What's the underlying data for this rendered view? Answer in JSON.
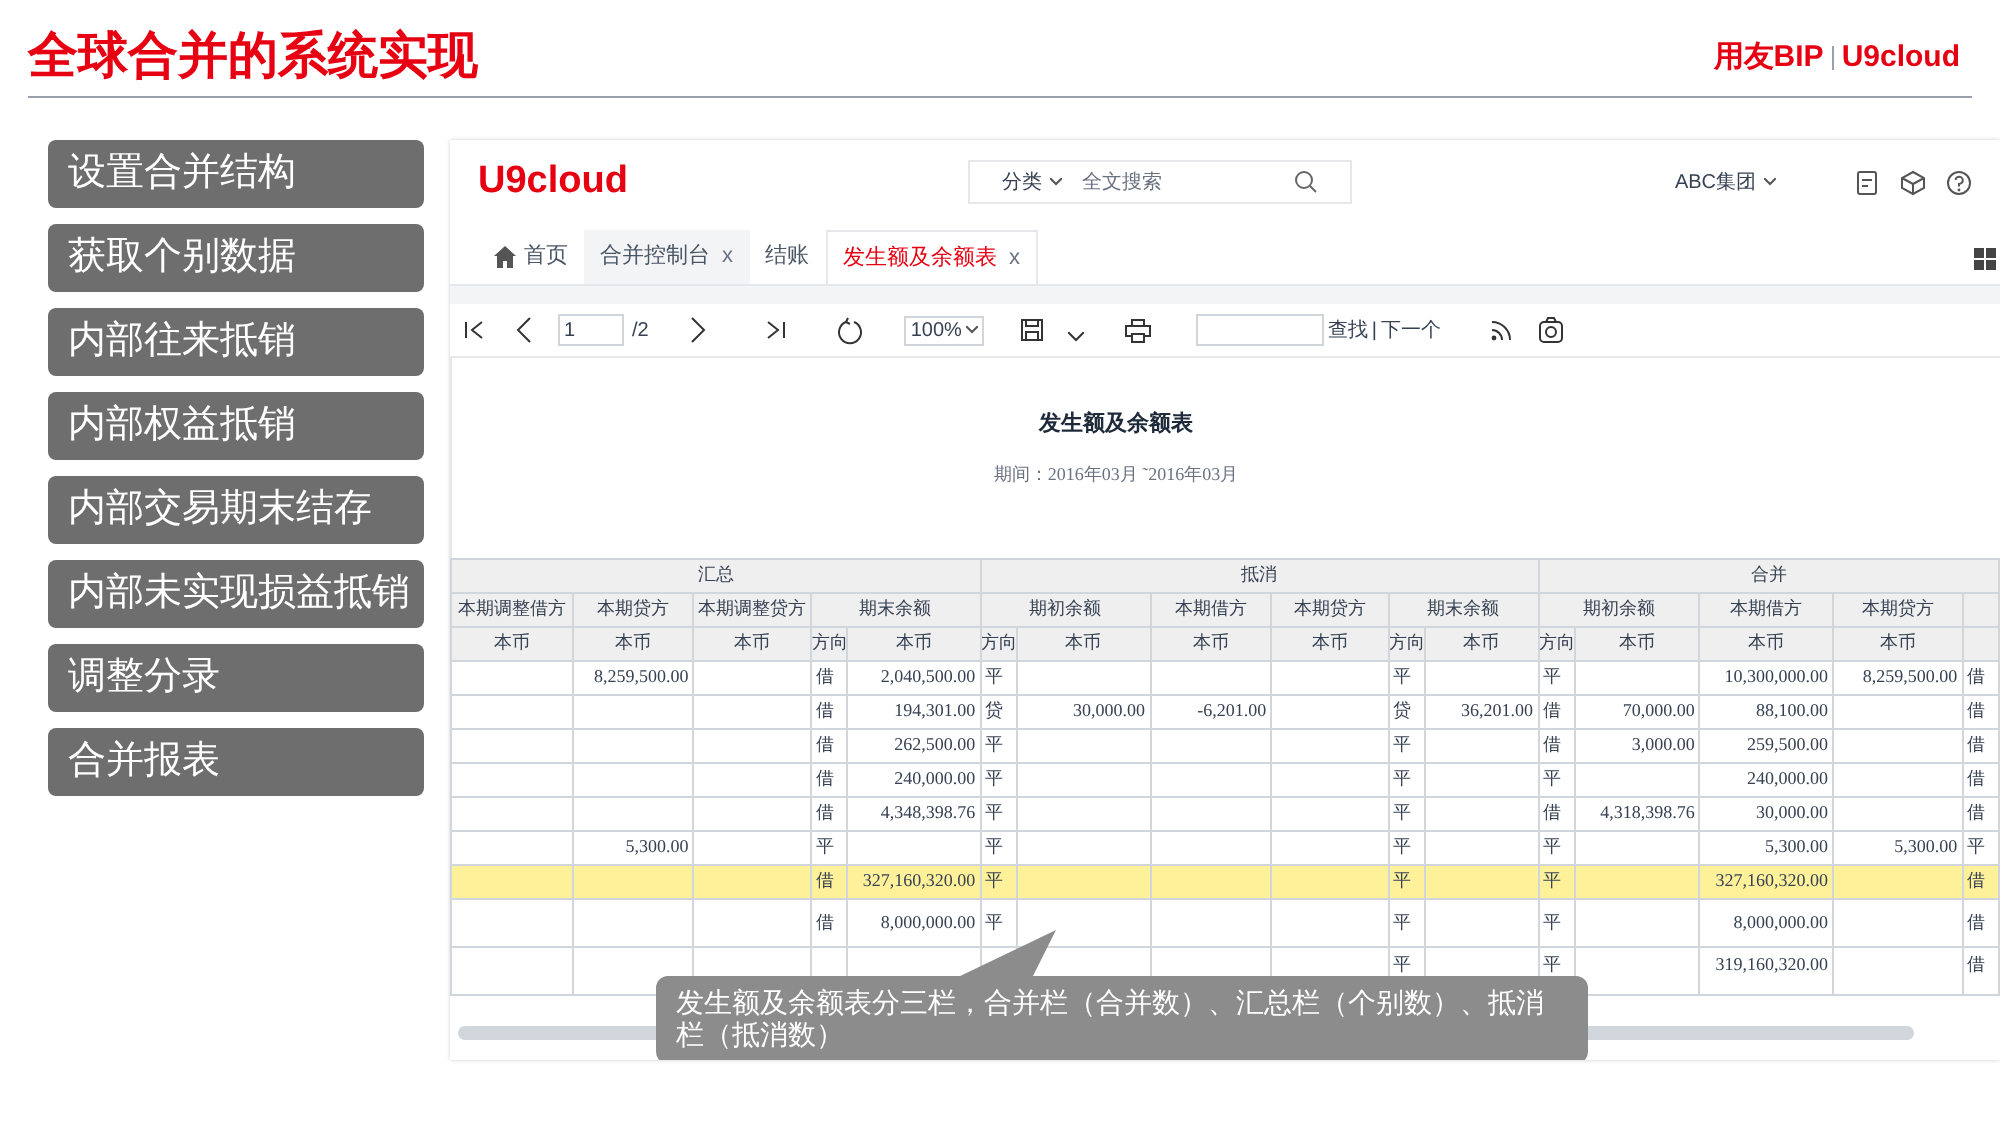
{
  "slide": {
    "title": "全球合并的系统实现",
    "brand": "用友BIP",
    "brand_product": "U9cloud"
  },
  "sidebar": {
    "items": [
      {
        "label": "设置合并结构"
      },
      {
        "label": "获取个别数据"
      },
      {
        "label": "内部往来抵销"
      },
      {
        "label": "内部权益抵销"
      },
      {
        "label": "内部交易期末结存"
      },
      {
        "label": "内部未实现损益抵销"
      },
      {
        "label": "调整分录"
      },
      {
        "label": "合并报表"
      }
    ]
  },
  "app": {
    "logo": "U9cloud",
    "search": {
      "category": "分类",
      "placeholder": "全文搜索"
    },
    "org": "ABC集团",
    "tabs": [
      {
        "label": "首页",
        "kind": "home",
        "selected": false
      },
      {
        "label": "合并控制台",
        "close": "x",
        "selected": false
      },
      {
        "label": "结账",
        "selected": false
      },
      {
        "label": "发生额及余额表",
        "close": "x",
        "selected": true
      }
    ],
    "toolbar": {
      "page": "1",
      "page_total": "/2",
      "zoom": "100%",
      "find": "查找",
      "separator": "|",
      "next": "下一个"
    },
    "report": {
      "title": "发生额及余额表",
      "period": "期间：2016年03月 ˜2016年03月"
    },
    "table": {
      "groups": [
        {
          "label": "汇总",
          "columns": [
            {
              "label": "本期调整借方",
              "sub": [
                "本币"
              ]
            },
            {
              "label": "本期贷方",
              "sub": [
                "本币"
              ]
            },
            {
              "label": "本期调整贷方",
              "sub": [
                "本币"
              ]
            },
            {
              "label": "期末余额",
              "sub": [
                "方向",
                "本币"
              ]
            }
          ]
        },
        {
          "label": "抵消",
          "columns": [
            {
              "label": "期初余额",
              "sub": [
                "方向",
                "本币"
              ]
            },
            {
              "label": "本期借方",
              "sub": [
                "本币"
              ]
            },
            {
              "label": "本期贷方",
              "sub": [
                "本币"
              ]
            },
            {
              "label": "期末余额",
              "sub": [
                "方向",
                "本币"
              ]
            }
          ]
        },
        {
          "label": "合并",
          "columns": [
            {
              "label": "期初余额",
              "sub": [
                "方向",
                "本币"
              ]
            },
            {
              "label": "本期借方",
              "sub": [
                "本币"
              ]
            },
            {
              "label": "本期贷方",
              "sub": [
                "本币"
              ]
            },
            {}
          ]
        }
      ],
      "rows": [
        {
          "highlighted": false,
          "cells": [
            null,
            "8,259,500.00",
            null,
            "借",
            "2,040,500.00",
            "平",
            null,
            null,
            null,
            "平",
            null,
            "平",
            null,
            "10,300,000.00",
            "8,259,500.00",
            "借"
          ]
        },
        {
          "highlighted": false,
          "cells": [
            null,
            null,
            null,
            "借",
            "194,301.00",
            "贷",
            "30,000.00",
            "-6,201.00",
            null,
            "贷",
            "36,201.00",
            "借",
            "70,000.00",
            "88,100.00",
            null,
            "借"
          ]
        },
        {
          "highlighted": false,
          "cells": [
            null,
            null,
            null,
            "借",
            "262,500.00",
            "平",
            null,
            null,
            null,
            "平",
            null,
            "借",
            "3,000.00",
            "259,500.00",
            null,
            "借"
          ]
        },
        {
          "highlighted": false,
          "cells": [
            null,
            null,
            null,
            "借",
            "240,000.00",
            "平",
            null,
            null,
            null,
            "平",
            null,
            "平",
            null,
            "240,000.00",
            null,
            "借"
          ]
        },
        {
          "highlighted": false,
          "cells": [
            null,
            null,
            null,
            "借",
            "4,348,398.76",
            "平",
            null,
            null,
            null,
            "平",
            null,
            "借",
            "4,318,398.76",
            "30,000.00",
            null,
            "借"
          ]
        },
        {
          "highlighted": false,
          "cells": [
            null,
            "5,300.00",
            null,
            "平",
            null,
            "平",
            null,
            null,
            null,
            "平",
            null,
            "平",
            null,
            "5,300.00",
            "5,300.00",
            "平"
          ]
        },
        {
          "highlighted": true,
          "cells": [
            null,
            null,
            null,
            "借",
            "327,160,320.00",
            "平",
            null,
            null,
            null,
            "平",
            null,
            "平",
            null,
            "327,160,320.00",
            null,
            "借"
          ]
        },
        {
          "highlighted": false,
          "cells": [
            null,
            null,
            null,
            "借",
            "8,000,000.00",
            "平",
            null,
            null,
            null,
            "平",
            null,
            "平",
            null,
            "8,000,000.00",
            null,
            "借"
          ]
        },
        {
          "highlighted": false,
          "cells": [
            null,
            null,
            null,
            null,
            null,
            null,
            null,
            null,
            null,
            "平",
            null,
            "平",
            null,
            "319,160,320.00",
            null,
            "借"
          ]
        }
      ]
    }
  },
  "callout": {
    "text": "发生额及余额表分三栏，合并栏（合并数）、汇总栏（个别数）、抵消栏（抵消数）"
  }
}
